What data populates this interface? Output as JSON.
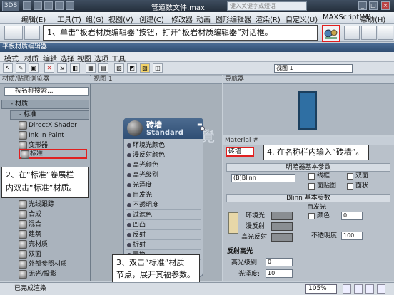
{
  "app": {
    "title": "管道数文件.max",
    "logo": "3DS",
    "search_placeholder": "键入关键字或短语",
    "window_controls": [
      "_",
      "□",
      "×"
    ]
  },
  "menu": [
    "编辑(E)",
    "工具(T)",
    "组(G)",
    "视图(V)",
    "创建(C)",
    "修改器",
    "动画",
    "图形编辑器",
    "渲染(R)",
    "自定义(U)",
    "MAXScript(M)",
    "帮助(H)"
  ],
  "callouts": {
    "step1": "1、单击“板岩材质编辑器”按钮，打开“板岩材质编辑器”对话框。",
    "step2_line1": "2、在“标准”卷展栏",
    "step2_line2": "内双击“标准”材质。",
    "step3_line1": "3、双击“标准”材质",
    "step3_line2": "节点，展开其福参数。",
    "step4": "4. 在名称栏内输入“砖墙”。"
  },
  "editor": {
    "title": "平板材质编辑器",
    "menu": [
      "模式",
      "材质",
      "编辑",
      "选择",
      "视图",
      "选项",
      "工具"
    ],
    "browser_header": "材质/贴图浏览器",
    "search_placeholder": "按名称搜索...",
    "group_material": "- 材质",
    "group_standard": "- 标准",
    "materials": [
      "DirectX Shader",
      "Ink 'n Paint",
      "变形器",
      "标准",
      "光线跟踪",
      "合成",
      "混合",
      "建筑",
      "壳材质",
      "双面",
      "外部参照材质",
      "无光/投影"
    ],
    "view_tab": "视图 1",
    "view_select": "视图 1",
    "navigator_header": "导航器",
    "watermark": "腾龍視覺"
  },
  "node": {
    "name": "砖墙",
    "type": "Standard",
    "slots": [
      "环境光颜色",
      "漫反射颜色",
      "高光颜色",
      "高光级别",
      "光泽度",
      "自发光",
      "不透明度",
      "过滤色",
      "凹凸",
      "反射",
      "折射",
      "置换"
    ]
  },
  "props": {
    "header": "Material #",
    "name_value": "砖墙",
    "roll_shader": "明暗器基本参数",
    "shader_value": "(B)Blinn",
    "shader_opts": [
      "线框",
      "双面",
      "面贴图",
      "面状"
    ],
    "roll_blinn": "Blinn 基本参数",
    "self_illum": "自发光",
    "color_label": "颜色",
    "color_value": "0",
    "ambient": "环境光:",
    "diffuse": "漫反射:",
    "specular": "高光反射:",
    "opacity_label": "不透明度:",
    "opacity_value": "100",
    "roll_spec": "反射高光",
    "spec_level_label": "高光级别:",
    "spec_level_value": "0",
    "gloss_label": "光泽度:",
    "gloss_value": "10"
  },
  "status": {
    "text": "已完成渲染",
    "zoom": "105%"
  }
}
